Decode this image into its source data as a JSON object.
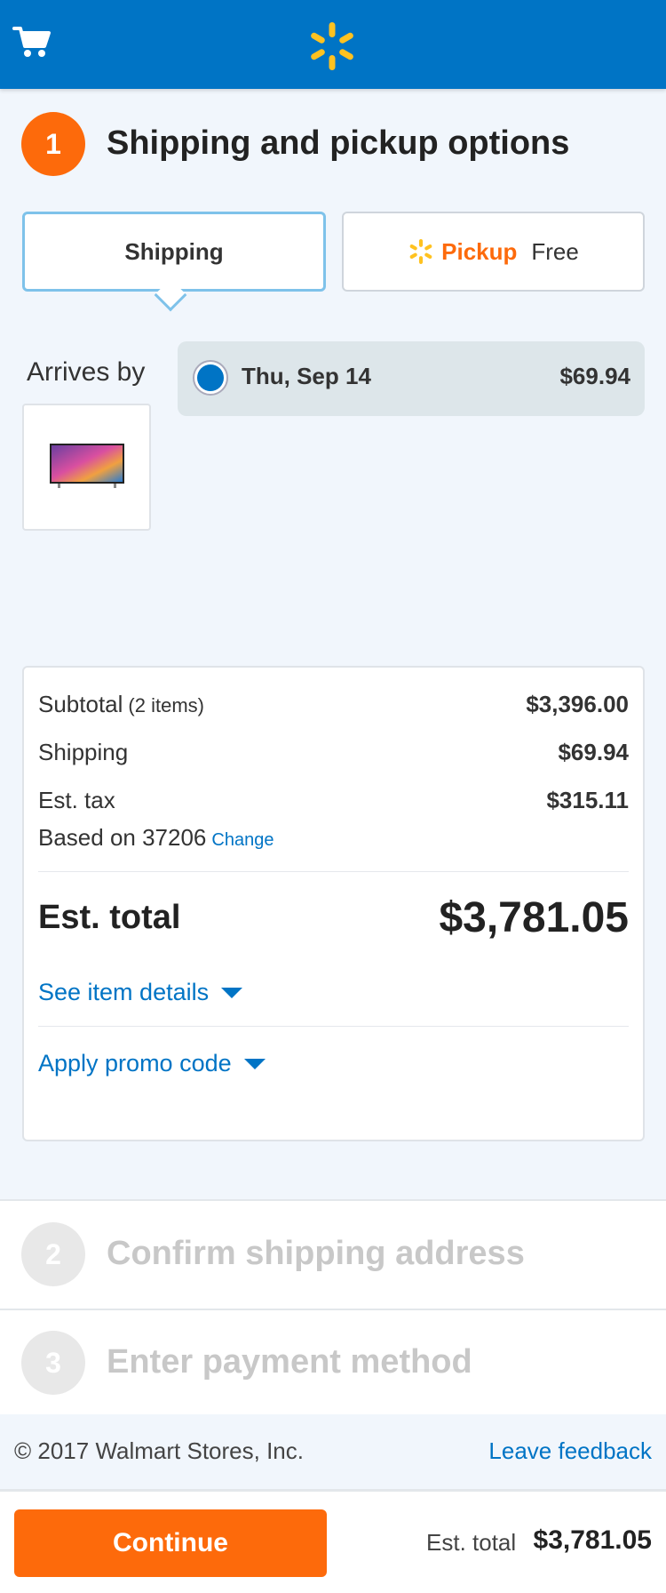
{
  "header": {
    "cart_icon": "cart-icon",
    "logo_icon": "walmart-spark-icon"
  },
  "step1": {
    "number": "1",
    "title": "Shipping and pickup options"
  },
  "tabs": {
    "shipping": "Shipping",
    "pickup_label": "Pickup",
    "pickup_price": "Free"
  },
  "delivery": {
    "arrives_label": "Arrives by",
    "option_date": "Thu, Sep 14",
    "option_price": "$69.94",
    "selected": true
  },
  "summary": {
    "subtotal_label": "Subtotal",
    "subtotal_items": "(2 items)",
    "subtotal_value": "$3,396.00",
    "shipping_label": "Shipping",
    "shipping_value": "$69.94",
    "tax_label": "Est. tax",
    "tax_value": "$315.11",
    "based_on": "Based on 37206",
    "change_link": "Change",
    "total_label": "Est. total",
    "total_value": "$3,781.05",
    "item_details_link": "See item details",
    "promo_link": "Apply promo code"
  },
  "steps": [
    {
      "number": "2",
      "title": "Confirm shipping address"
    },
    {
      "number": "3",
      "title": "Enter payment method"
    }
  ],
  "footer": {
    "copyright": "© 2017 Walmart Stores, Inc.",
    "feedback": "Leave feedback"
  },
  "bottom_bar": {
    "continue_label": "Continue",
    "est_total_label": "Est. total",
    "est_total_value": "$3,781.05"
  },
  "colors": {
    "brand_blue": "#0074c5",
    "accent_orange": "#fd6a0b",
    "spark_yellow": "#ffc220"
  }
}
